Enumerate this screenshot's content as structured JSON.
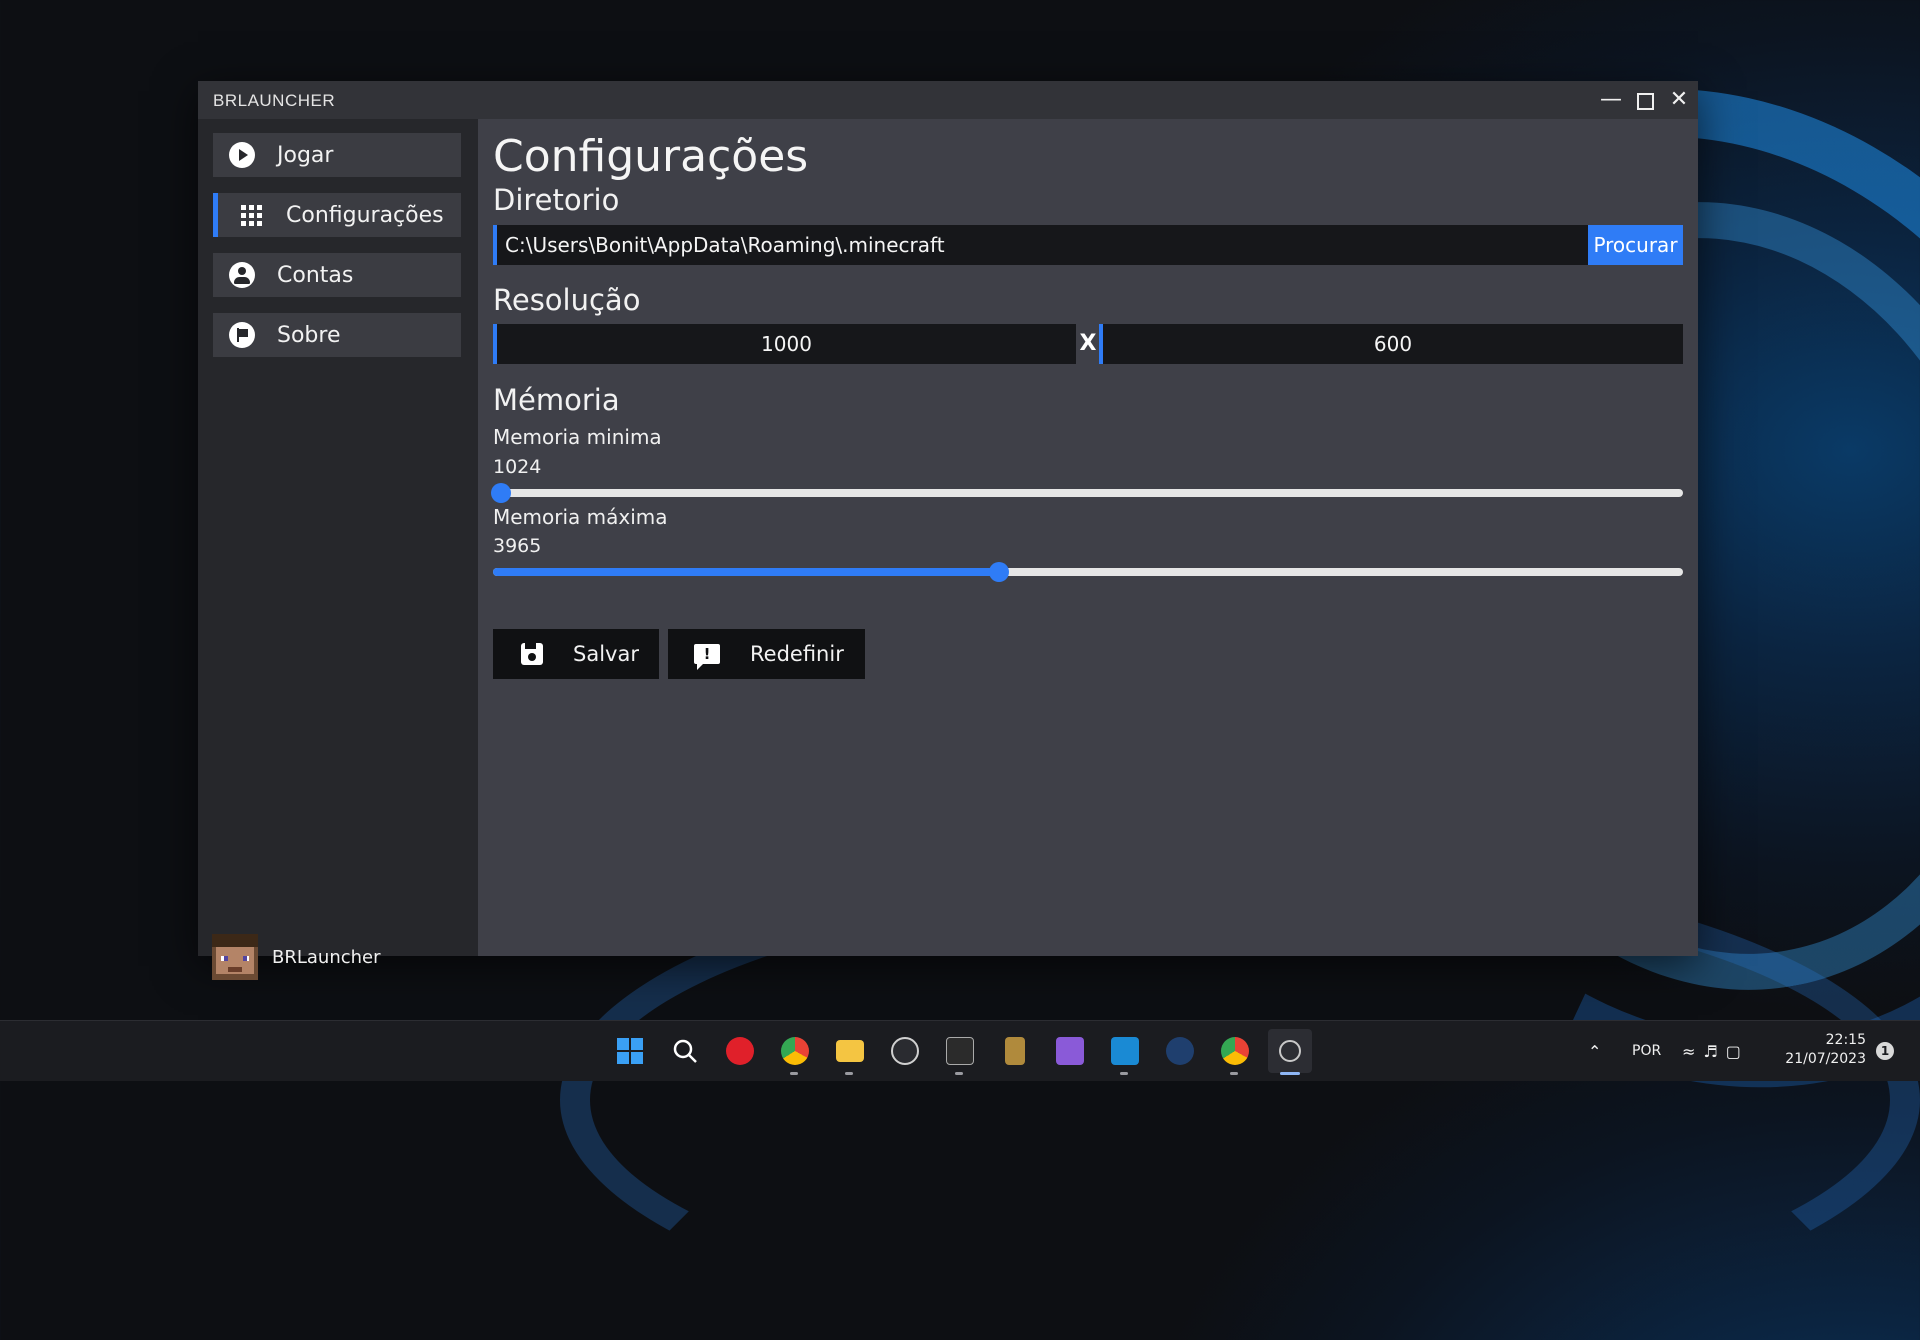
{
  "window": {
    "title": "BRLAUNCHER"
  },
  "sidebar": {
    "items": [
      {
        "label": "Jogar",
        "icon": "play-circle-icon"
      },
      {
        "label": "Configurações",
        "icon": "grid-icon",
        "active": true
      },
      {
        "label": "Contas",
        "icon": "account-circle-icon"
      },
      {
        "label": "Sobre",
        "icon": "flag-icon"
      }
    ],
    "user": {
      "name": "BRLauncher"
    }
  },
  "settings": {
    "title": "Configurações",
    "directory": {
      "heading": "Diretorio",
      "value": "C:\\Users\\Bonit\\AppData\\Roaming\\.minecraft",
      "browse_label": "Procurar"
    },
    "resolution": {
      "heading": "Resolução",
      "width": "1000",
      "separator": "X",
      "height": "600"
    },
    "memory": {
      "heading": "Mémoria",
      "min_label": "Memoria minima",
      "min_value": "1024",
      "min_fraction": 0.0,
      "max_label": "Memoria máxima",
      "max_value": "3965",
      "max_fraction": 0.425
    },
    "actions": {
      "save_label": "Salvar",
      "reset_label": "Redefinir"
    }
  },
  "taskbar": {
    "apps": [
      "windows-start-icon",
      "search-icon",
      "anydesk-icon",
      "chrome-icon",
      "file-explorer-icon",
      "obs-icon",
      "epic-games-icon",
      "league-of-legends-icon",
      "visual-studio-icon",
      "vscode-icon",
      "steam-icon",
      "chrome-canary-icon",
      "brlauncher-icon"
    ],
    "language": "POR",
    "time": "22:15",
    "date": "21/07/2023",
    "notification_count": "1"
  },
  "colors": {
    "accent": "#2f7cf6",
    "window_bg": "#3f4048",
    "sidebar_bg": "#26272b"
  }
}
